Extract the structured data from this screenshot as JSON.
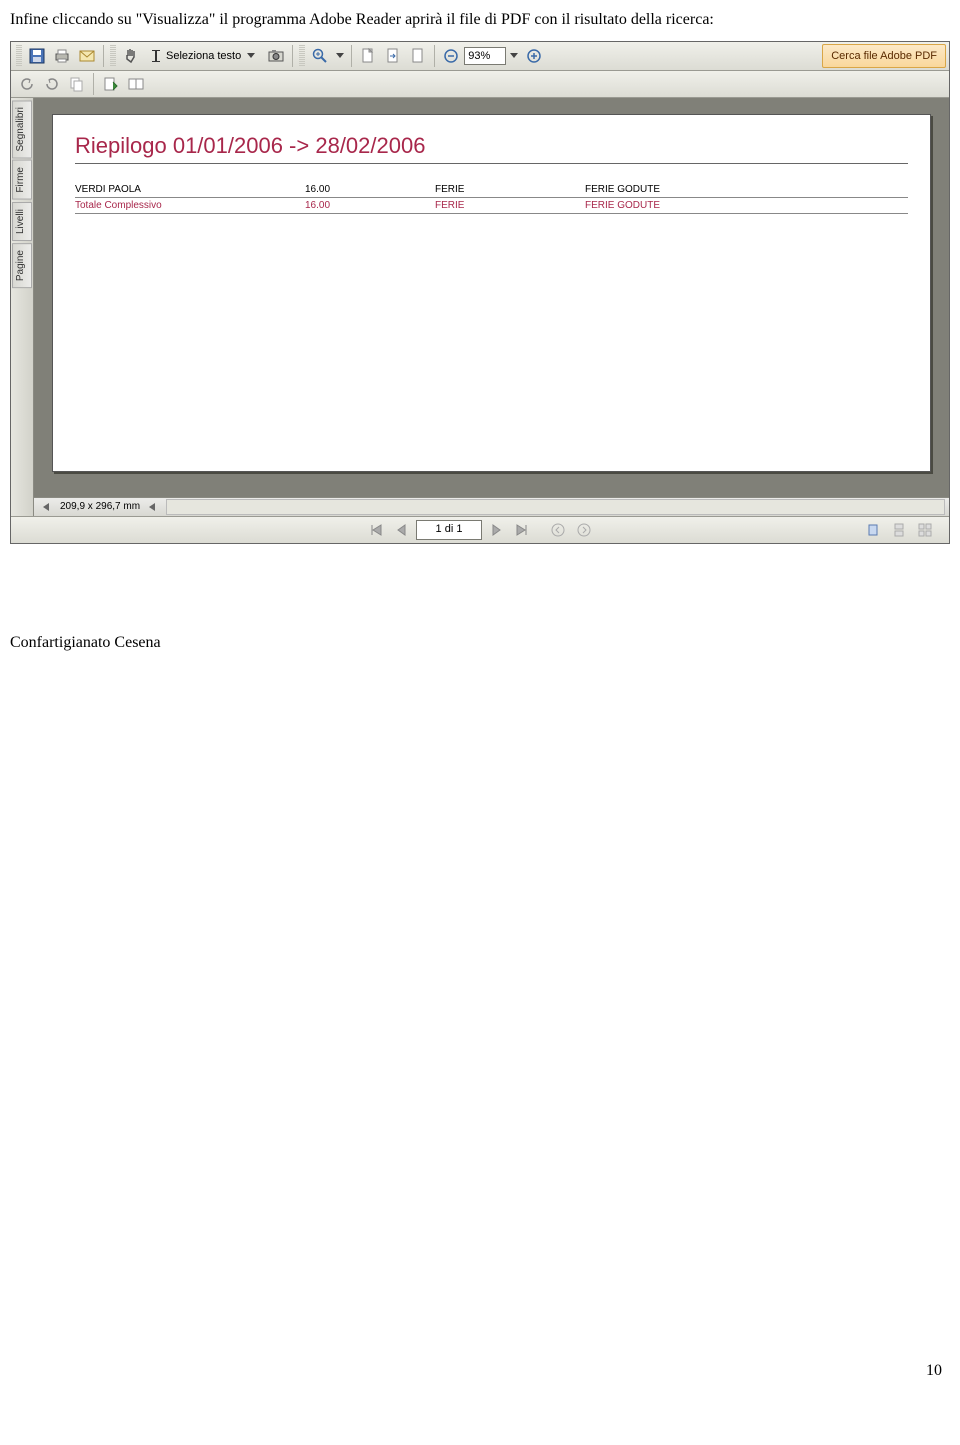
{
  "intro": "Infine cliccando su \"Visualizza\" il programma Adobe Reader aprirà il file di PDF con il risultato della ricerca:",
  "toolbar": {
    "select_text": "Seleziona testo",
    "zoom_value": "93%",
    "search_label": "Cerca file Adobe PDF"
  },
  "side_tabs": [
    "Segnalibri",
    "Firme",
    "Livelli",
    "Pagine"
  ],
  "doc": {
    "title": "Riepilogo 01/01/2006 -> 28/02/2006",
    "rows": [
      {
        "name": "VERDI PAOLA",
        "val": "16.00",
        "type": "FERIE",
        "desc": "FERIE GODUTE"
      },
      {
        "name": "Totale Complessivo",
        "val": "16.00",
        "type": "FERIE",
        "desc": "FERIE GODUTE"
      }
    ]
  },
  "status": {
    "dims": "209,9 x 296,7 mm"
  },
  "nav": {
    "page": "1 di 1"
  },
  "credit": "Confartigianato Cesena",
  "pagenum": "10"
}
